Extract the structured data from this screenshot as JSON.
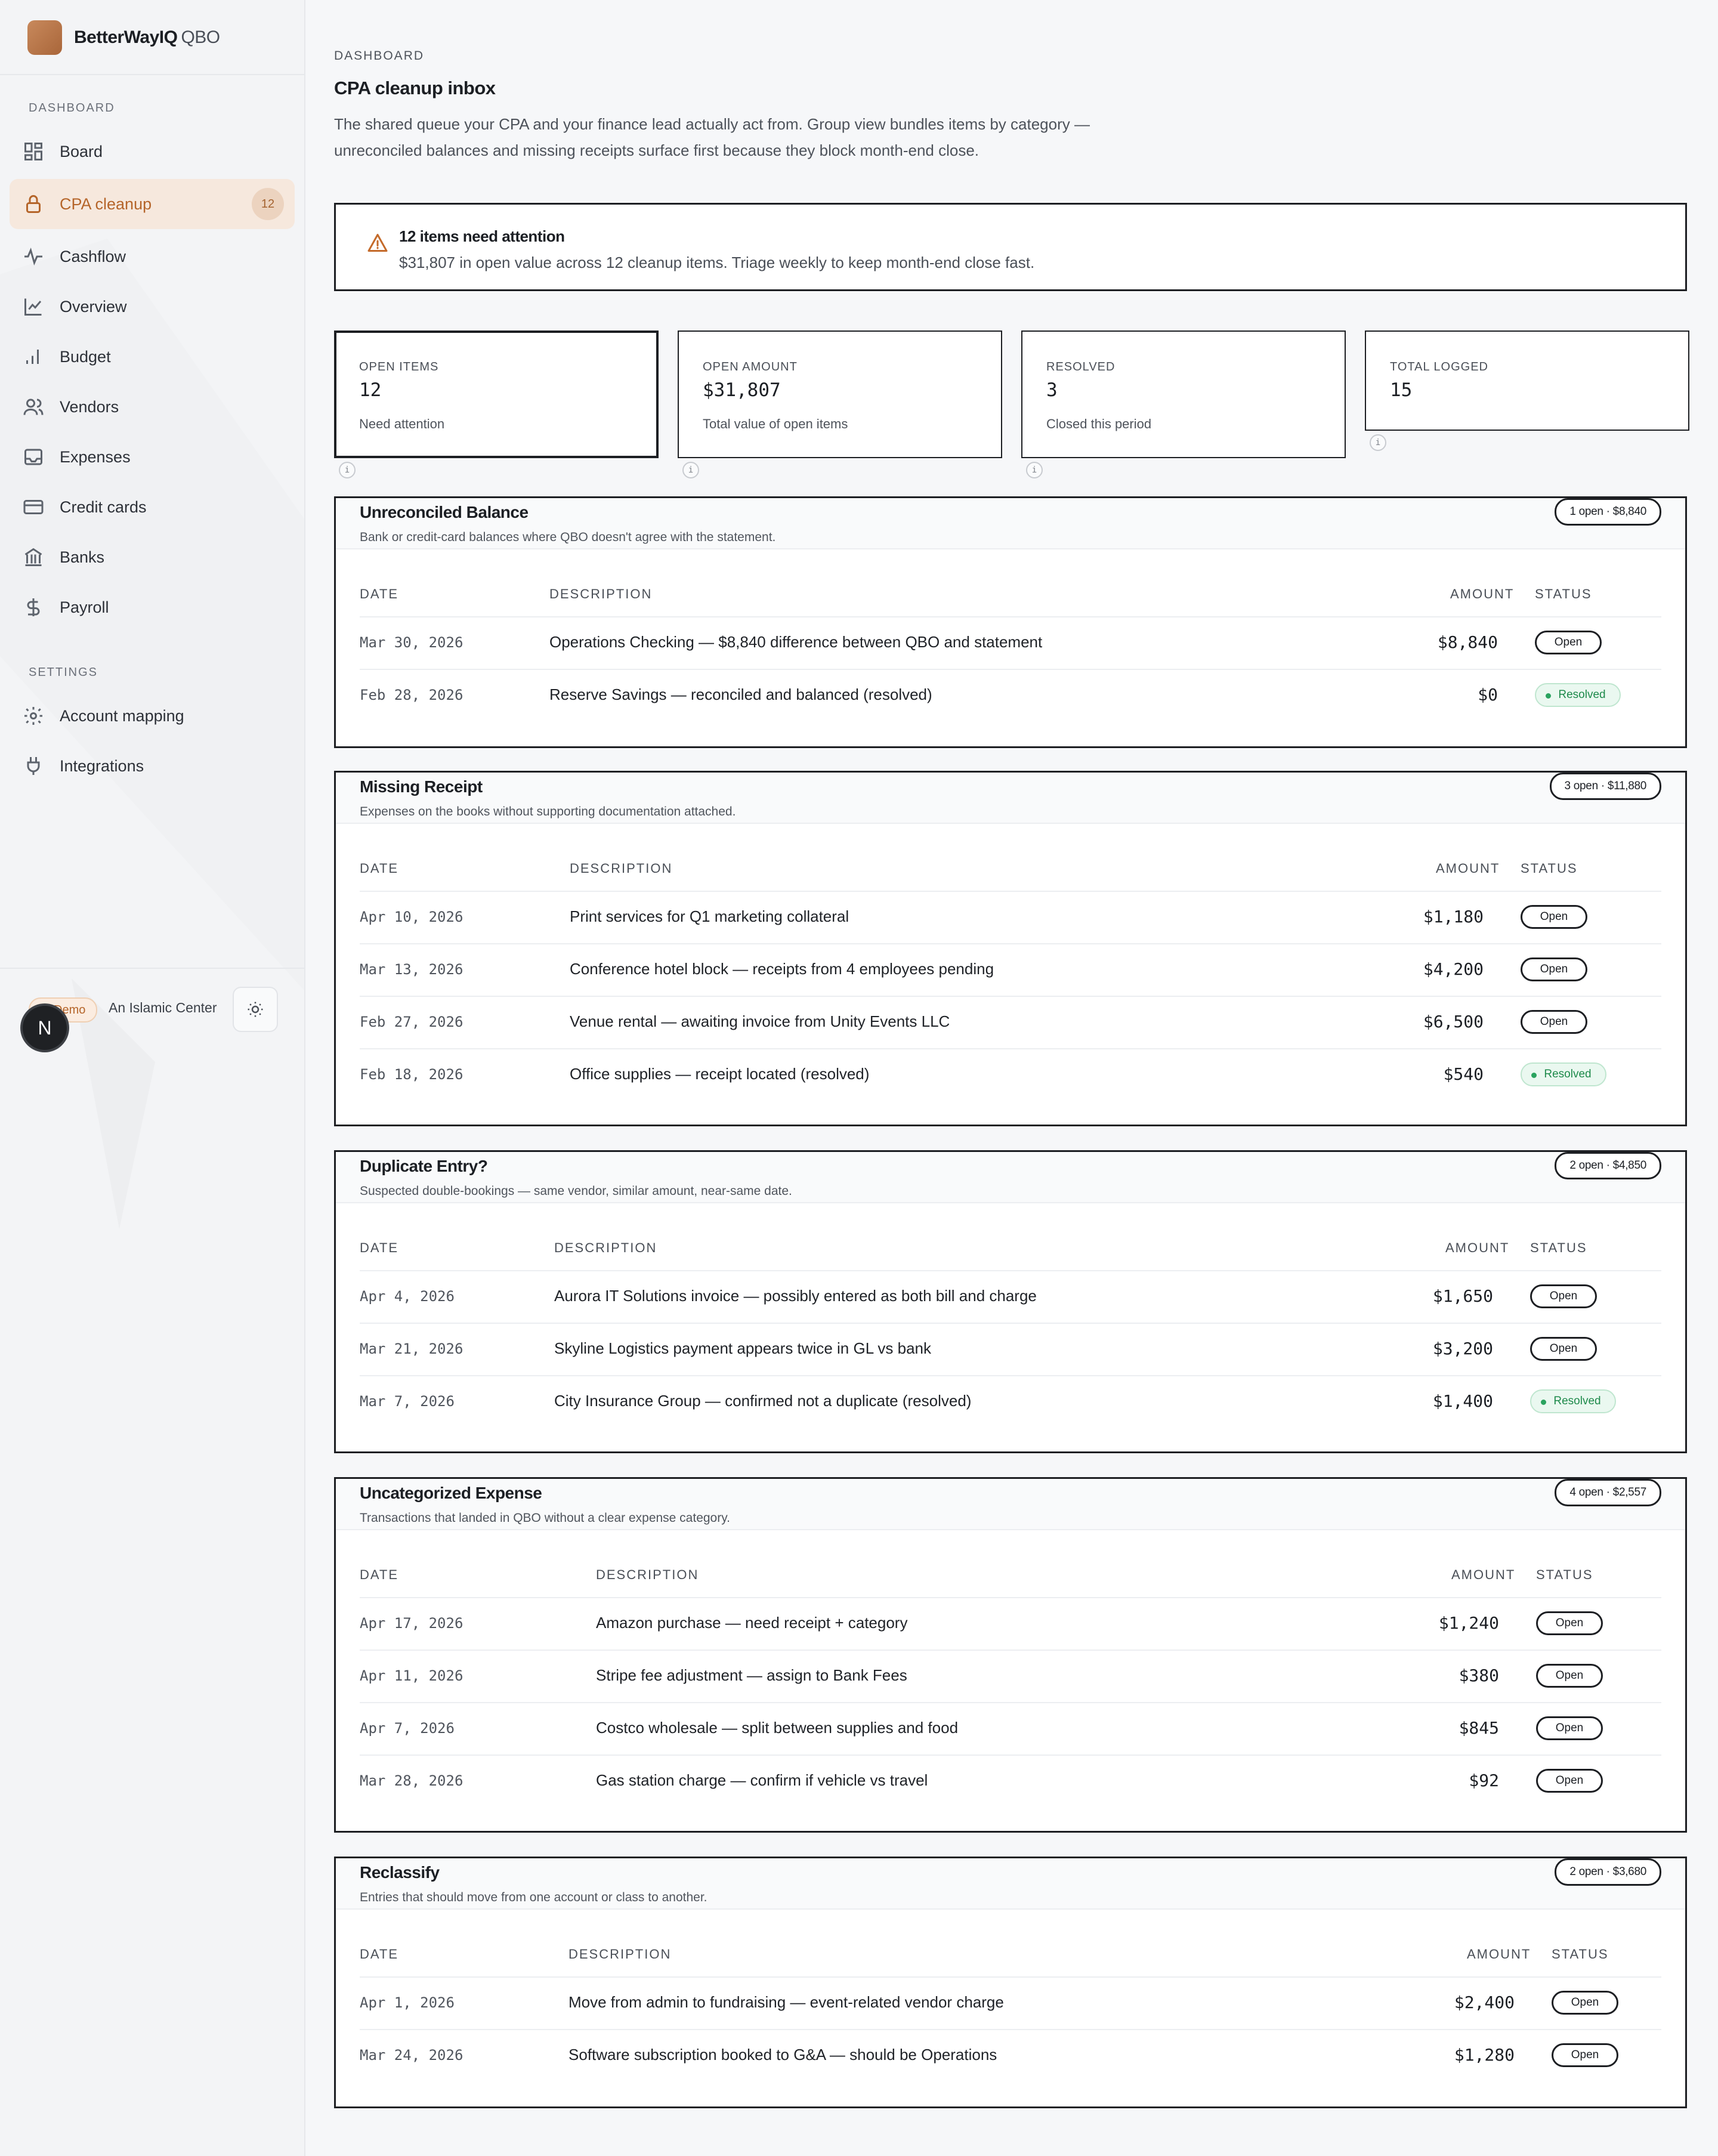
{
  "brand": {
    "name": "BetterWayIQ",
    "product": "QBO"
  },
  "sidebar": {
    "dashboard_label": "DASHBOARD",
    "settings_label": "SETTINGS",
    "items": [
      {
        "label": "Board",
        "icon": "grid-icon"
      },
      {
        "label": "CPA cleanup",
        "icon": "lock-icon",
        "badge": "12",
        "active": true
      },
      {
        "label": "Cashflow",
        "icon": "pulse-icon"
      },
      {
        "label": "Overview",
        "icon": "line-chart-icon"
      },
      {
        "label": "Budget",
        "icon": "bar-chart-icon"
      },
      {
        "label": "Vendors",
        "icon": "users-icon"
      },
      {
        "label": "Expenses",
        "icon": "inbox-icon"
      },
      {
        "label": "Credit cards",
        "icon": "credit-card-icon"
      },
      {
        "label": "Banks",
        "icon": "bank-icon"
      },
      {
        "label": "Payroll",
        "icon": "dollar-icon"
      }
    ],
    "settings_items": [
      {
        "label": "Account mapping",
        "icon": "gear-icon"
      },
      {
        "label": "Integrations",
        "icon": "plug-icon"
      }
    ],
    "demo_badge": "Demo",
    "org_name": "An Islamic Center",
    "avatar_initial": "N"
  },
  "header": {
    "eyebrow": "DASHBOARD",
    "title": "CPA cleanup inbox",
    "description": "The shared queue your CPA and your finance lead actually act from. Group view bundles items by category — unreconciled balances and missing receipts surface first because they block month-end close."
  },
  "alert": {
    "title": "12 items need attention",
    "body": "$31,807 in open value across 12 cleanup items. Triage weekly to keep month-end close fast."
  },
  "stats": [
    {
      "label": "OPEN ITEMS",
      "value": "12",
      "sub": "Need attention"
    },
    {
      "label": "OPEN AMOUNT",
      "value": "$31,807",
      "sub": "Total value of open items"
    },
    {
      "label": "RESOLVED",
      "value": "3",
      "sub": "Closed this period"
    },
    {
      "label": "TOTAL LOGGED",
      "value": "15",
      "sub": ""
    }
  ],
  "info_glyph": "i",
  "table_headers": {
    "date": "DATE",
    "description": "DESCRIPTION",
    "amount": "AMOUNT",
    "status": "STATUS"
  },
  "status_labels": {
    "open": "Open",
    "resolved": "Resolved"
  },
  "categories": [
    {
      "title": "Unreconciled Balance",
      "description": "Bank or credit-card balances where QBO doesn't agree with the statement.",
      "summary": "1 open · $8,840",
      "rows": [
        {
          "date": "Mar 30, 2026",
          "description": "Operations Checking — $8,840 difference between QBO and statement",
          "amount": "$8,840",
          "status": "Open"
        },
        {
          "date": "Feb 28, 2026",
          "description": "Reserve Savings — reconciled and balanced (resolved)",
          "amount": "$0",
          "status": "Resolved"
        }
      ]
    },
    {
      "title": "Missing Receipt",
      "description": "Expenses on the books without supporting documentation attached.",
      "summary": "3 open · $11,880",
      "rows": [
        {
          "date": "Apr 10, 2026",
          "description": "Print services for Q1 marketing collateral",
          "amount": "$1,180",
          "status": "Open"
        },
        {
          "date": "Mar 13, 2026",
          "description": "Conference hotel block — receipts from 4 employees pending",
          "amount": "$4,200",
          "status": "Open"
        },
        {
          "date": "Feb 27, 2026",
          "description": "Venue rental — awaiting invoice from Unity Events LLC",
          "amount": "$6,500",
          "status": "Open"
        },
        {
          "date": "Feb 18, 2026",
          "description": "Office supplies — receipt located (resolved)",
          "amount": "$540",
          "status": "Resolved"
        }
      ]
    },
    {
      "title": "Duplicate Entry?",
      "description": "Suspected double-bookings — same vendor, similar amount, near-same date.",
      "summary": "2 open · $4,850",
      "rows": [
        {
          "date": "Apr 4, 2026",
          "description": "Aurora IT Solutions invoice — possibly entered as both bill and charge",
          "amount": "$1,650",
          "status": "Open"
        },
        {
          "date": "Mar 21, 2026",
          "description": "Skyline Logistics payment appears twice in GL vs bank",
          "amount": "$3,200",
          "status": "Open"
        },
        {
          "date": "Mar 7, 2026",
          "description": "City Insurance Group — confirmed not a duplicate (resolved)",
          "amount": "$1,400",
          "status": "Resolved"
        }
      ]
    },
    {
      "title": "Uncategorized Expense",
      "description": "Transactions that landed in QBO without a clear expense category.",
      "summary": "4 open · $2,557",
      "rows": [
        {
          "date": "Apr 17, 2026",
          "description": "Amazon purchase — need receipt + category",
          "amount": "$1,240",
          "status": "Open"
        },
        {
          "date": "Apr 11, 2026",
          "description": "Stripe fee adjustment — assign to Bank Fees",
          "amount": "$380",
          "status": "Open"
        },
        {
          "date": "Apr 7, 2026",
          "description": "Costco wholesale — split between supplies and food",
          "amount": "$845",
          "status": "Open"
        },
        {
          "date": "Mar 28, 2026",
          "description": "Gas station charge — confirm if vehicle vs travel",
          "amount": "$92",
          "status": "Open"
        }
      ]
    },
    {
      "title": "Reclassify",
      "description": "Entries that should move from one account or class to another.",
      "summary": "2 open · $3,680",
      "rows": [
        {
          "date": "Apr 1, 2026",
          "description": "Move from admin to fundraising — event-related vendor charge",
          "amount": "$2,400",
          "status": "Open"
        },
        {
          "date": "Mar 24, 2026",
          "description": "Software subscription booked to G&A — should be Operations",
          "amount": "$1,280",
          "status": "Open"
        }
      ]
    }
  ]
}
